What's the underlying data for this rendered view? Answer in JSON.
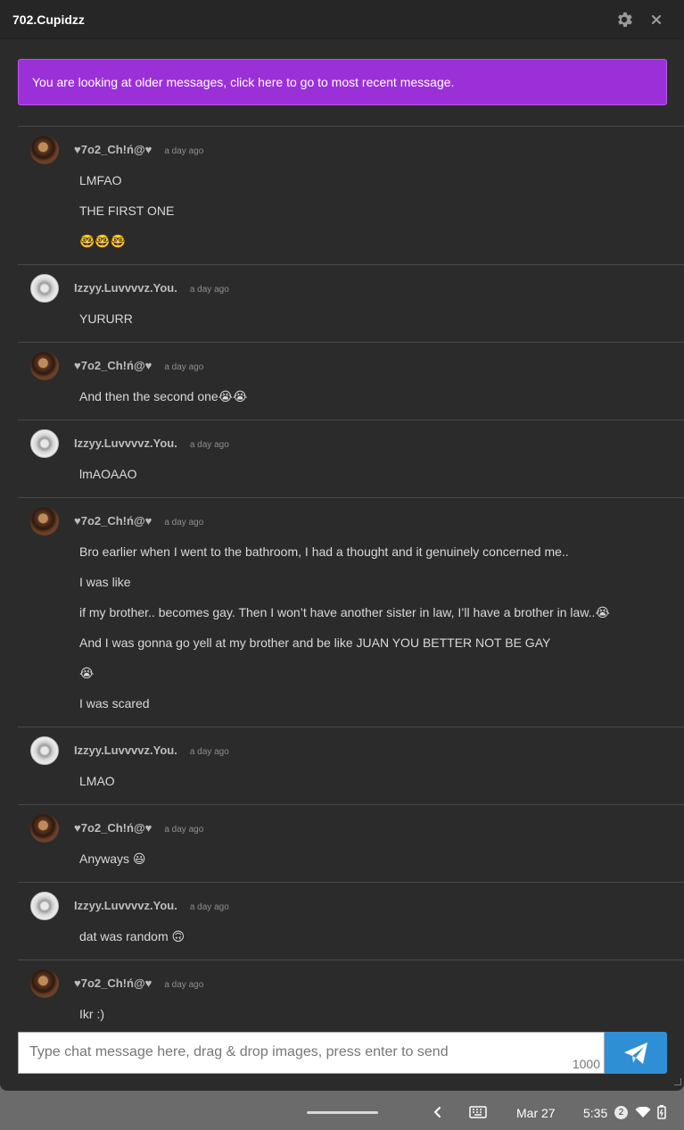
{
  "window": {
    "title": "702.Cupidzz"
  },
  "banner": {
    "text": "You are looking at older messages, click here to go to most recent message."
  },
  "messages": [
    {
      "author": "♥7o2_Ch!ń@♥",
      "time": "a day ago",
      "avatar": "chi",
      "lines": [
        "LMFAO",
        "THE FIRST ONE",
        "🤓🤓🤓"
      ]
    },
    {
      "author": "Izzyy.Luvvvvz.You.",
      "time": "a day ago",
      "avatar": "izz",
      "lines": [
        "YURURR"
      ]
    },
    {
      "author": "♥7o2_Ch!ń@♥",
      "time": "a day ago",
      "avatar": "chi",
      "lines": [
        "And then the second one😭😭"
      ]
    },
    {
      "author": "Izzyy.Luvvvvz.You.",
      "time": "a day ago",
      "avatar": "izz",
      "lines": [
        "lmAOAAO"
      ]
    },
    {
      "author": "♥7o2_Ch!ń@♥",
      "time": "a day ago",
      "avatar": "chi",
      "lines": [
        "Bro earlier when I went to the bathroom, I had a thought and it genuinely concerned me..",
        "I was like",
        "if my brother.. becomes gay. Then I won’t have another sister in law, I’ll have a brother in law..😭",
        "And I was gonna go yell at my brother and be like JUAN YOU BETTER NOT BE GAY",
        "😭",
        "I was scared"
      ]
    },
    {
      "author": "Izzyy.Luvvvvz.You.",
      "time": "a day ago",
      "avatar": "izz",
      "lines": [
        "LMAO"
      ]
    },
    {
      "author": "♥7o2_Ch!ń@♥",
      "time": "a day ago",
      "avatar": "chi",
      "lines": [
        "Anyways 😃"
      ]
    },
    {
      "author": "Izzyy.Luvvvvz.You.",
      "time": "a day ago",
      "avatar": "izz",
      "lines": [
        "dat was random 🙃"
      ]
    },
    {
      "author": "♥7o2_Ch!ń@♥",
      "time": "a day ago",
      "avatar": "chi",
      "lines": [
        "Ikr :)"
      ]
    }
  ],
  "input": {
    "placeholder": "Type chat message here, drag & drop images, press enter to send",
    "value": "",
    "char_count": "1000"
  },
  "shelf": {
    "date": "Mar 27",
    "clock": "5:35",
    "notifications": "2"
  },
  "colors": {
    "banner": "#9b30d9",
    "send": "#2f8fd4",
    "background": "#2b2b2b"
  }
}
